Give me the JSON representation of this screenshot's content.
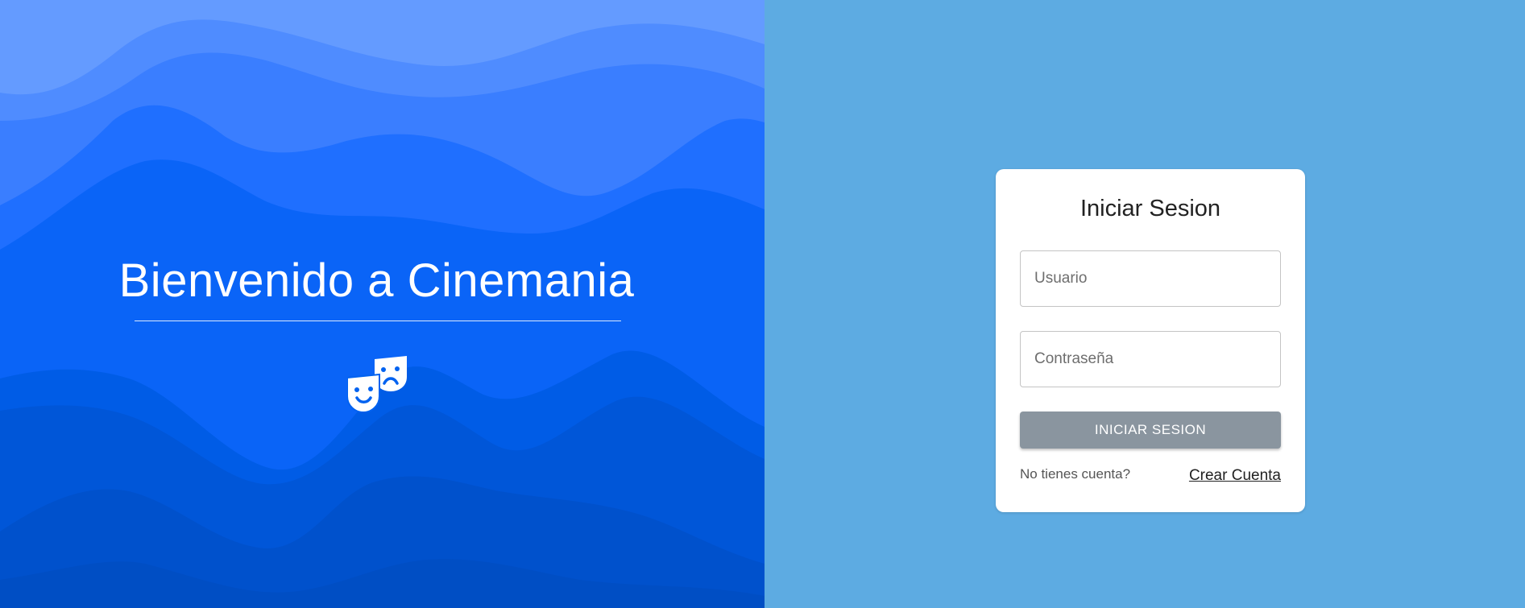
{
  "welcome": {
    "title": "Bienvenido a Cinemania",
    "logo_icon": "theater-masks-icon"
  },
  "login": {
    "title": "Iniciar Sesion",
    "username_placeholder": "Usuario",
    "password_placeholder": "Contraseña",
    "submit_label": "INICIAR SESION",
    "no_account_text": "No tienes cuenta?",
    "create_account_label": "Crear Cuenta"
  },
  "colors": {
    "left_background": "#0062f0",
    "right_background": "#5dabe2",
    "button": "#8a959f",
    "card": "#ffffff"
  }
}
